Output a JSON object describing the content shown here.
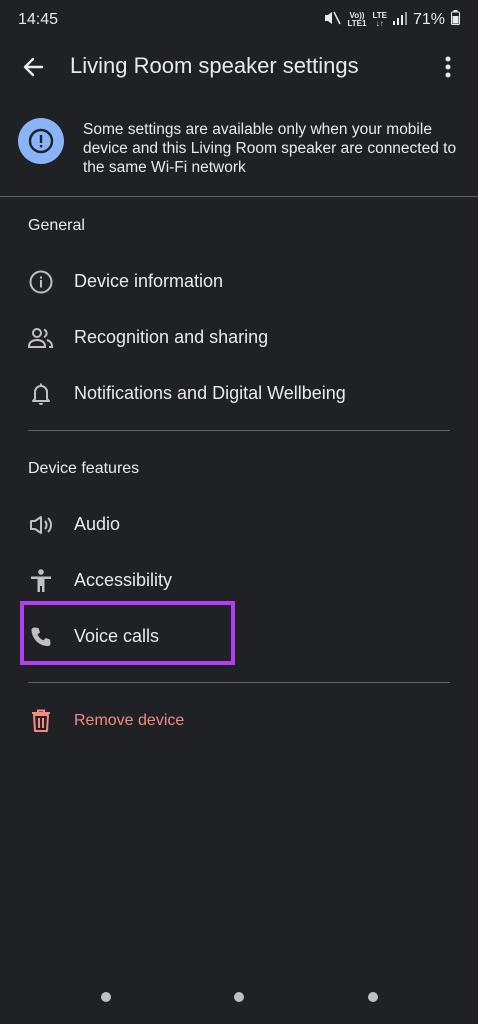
{
  "status": {
    "time": "14:45",
    "volte": "Vo))",
    "lte1": "LTE1",
    "lte": "LTE",
    "battery": "71%"
  },
  "appbar": {
    "title": "Living Room speaker settings"
  },
  "banner": {
    "text": "Some settings are available only when your mobile device and this Living Room speaker are connected to the same Wi-Fi network"
  },
  "general": {
    "title": "General",
    "items": [
      {
        "label": "Device information",
        "icon": "info-icon"
      },
      {
        "label": "Recognition and sharing",
        "icon": "people-icon"
      },
      {
        "label": "Notifications and Digital Wellbeing",
        "icon": "bell-icon"
      }
    ]
  },
  "features": {
    "title": "Device features",
    "items": [
      {
        "label": "Audio",
        "icon": "speaker-icon"
      },
      {
        "label": "Accessibility",
        "icon": "accessibility-icon"
      },
      {
        "label": "Voice calls",
        "icon": "phone-icon"
      }
    ]
  },
  "remove": {
    "label": "Remove device",
    "icon": "trash-icon"
  },
  "colors": {
    "background": "#202124",
    "accent": "#8ab4f8",
    "danger": "#f28b82",
    "highlight": "#b43df2"
  }
}
